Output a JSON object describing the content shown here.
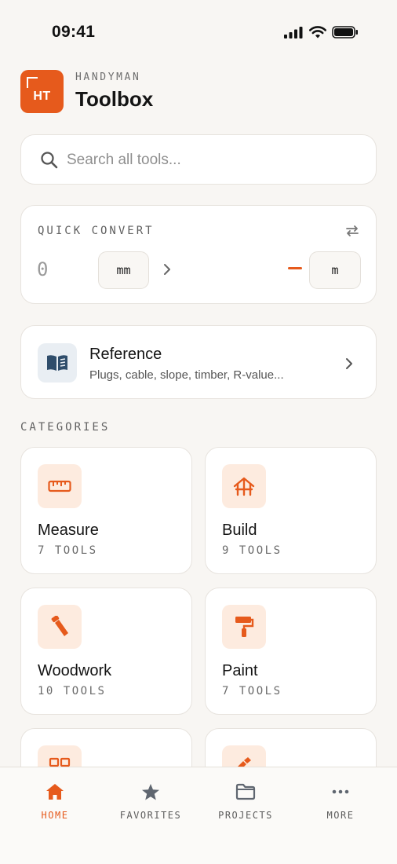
{
  "status_bar": {
    "time": "09:41"
  },
  "header": {
    "logo_text": "HT",
    "kicker": "HANDYMAN",
    "title": "Toolbox"
  },
  "search": {
    "placeholder": "Search all tools...",
    "value": ""
  },
  "quick_convert": {
    "label": "QUICK CONVERT",
    "input_value": "0",
    "from_unit": "mm",
    "to_unit": "m",
    "result": "—"
  },
  "reference": {
    "title": "Reference",
    "subtitle": "Plugs, cable, slope, timber, R-value..."
  },
  "categories": {
    "label": "CATEGORIES",
    "items": [
      {
        "name": "Measure",
        "count": "7 TOOLS",
        "icon": "ruler-icon"
      },
      {
        "name": "Build",
        "count": "9 TOOLS",
        "icon": "house-frame-icon"
      },
      {
        "name": "Woodwork",
        "count": "10 TOOLS",
        "icon": "saw-icon"
      },
      {
        "name": "Paint",
        "count": "7 TOOLS",
        "icon": "paint-roller-icon"
      },
      {
        "name": "",
        "count": "",
        "icon": "tiles-icon"
      },
      {
        "name": "",
        "count": "",
        "icon": "plumbing-icon"
      }
    ]
  },
  "tab_bar": {
    "items": [
      {
        "label": "HOME",
        "icon": "home-icon",
        "active": true
      },
      {
        "label": "FAVORITES",
        "icon": "star-icon",
        "active": false
      },
      {
        "label": "PROJECTS",
        "icon": "folder-icon",
        "active": false
      },
      {
        "label": "MORE",
        "icon": "more-icon",
        "active": false
      }
    ]
  },
  "colors": {
    "accent": "#e65a1c",
    "background": "#f8f6f3",
    "icon_tint_bg": "#fdebdf",
    "reference_icon_bg": "#e9eef3",
    "reference_icon": "#2f4d6b"
  }
}
